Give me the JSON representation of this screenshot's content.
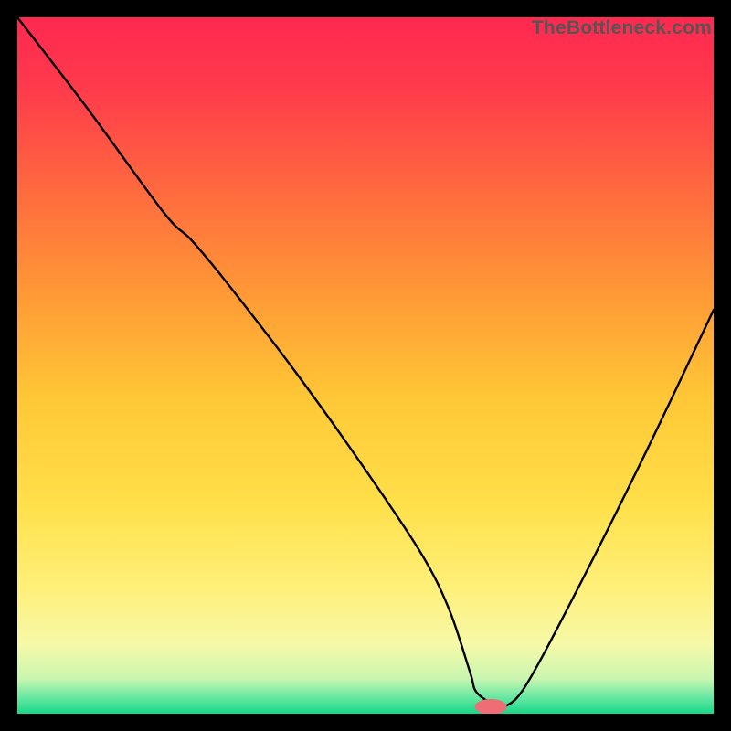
{
  "watermark": "TheBottleneck.com",
  "chart_data": {
    "type": "line",
    "title": "",
    "xlabel": "",
    "ylabel": "",
    "xlim": [
      0,
      100
    ],
    "ylim": [
      0,
      100
    ],
    "series": [
      {
        "name": "curve",
        "x": [
          0,
          10,
          21,
          25,
          30,
          40,
          50,
          58,
          62,
          65,
          66,
          69,
          70,
          73,
          80,
          90,
          100
        ],
        "y": [
          100,
          87,
          72,
          68,
          62,
          49,
          35,
          23,
          15,
          6,
          3,
          1,
          1,
          4,
          17,
          37,
          58
        ]
      }
    ],
    "marker": {
      "x": 68,
      "y": 1,
      "rx": 2.3,
      "ry": 1.1,
      "color": "#ef6d74"
    },
    "gradient_stops": [
      {
        "offset": 0.0,
        "color": "#ff2850"
      },
      {
        "offset": 0.1,
        "color": "#ff3a4c"
      },
      {
        "offset": 0.25,
        "color": "#ff6a3e"
      },
      {
        "offset": 0.4,
        "color": "#ff9a36"
      },
      {
        "offset": 0.55,
        "color": "#ffc836"
      },
      {
        "offset": 0.7,
        "color": "#ffe04a"
      },
      {
        "offset": 0.82,
        "color": "#fff07a"
      },
      {
        "offset": 0.9,
        "color": "#f6f9a8"
      },
      {
        "offset": 0.95,
        "color": "#c9f6b0"
      },
      {
        "offset": 0.975,
        "color": "#6de9a4"
      },
      {
        "offset": 1.0,
        "color": "#17d788"
      }
    ]
  }
}
